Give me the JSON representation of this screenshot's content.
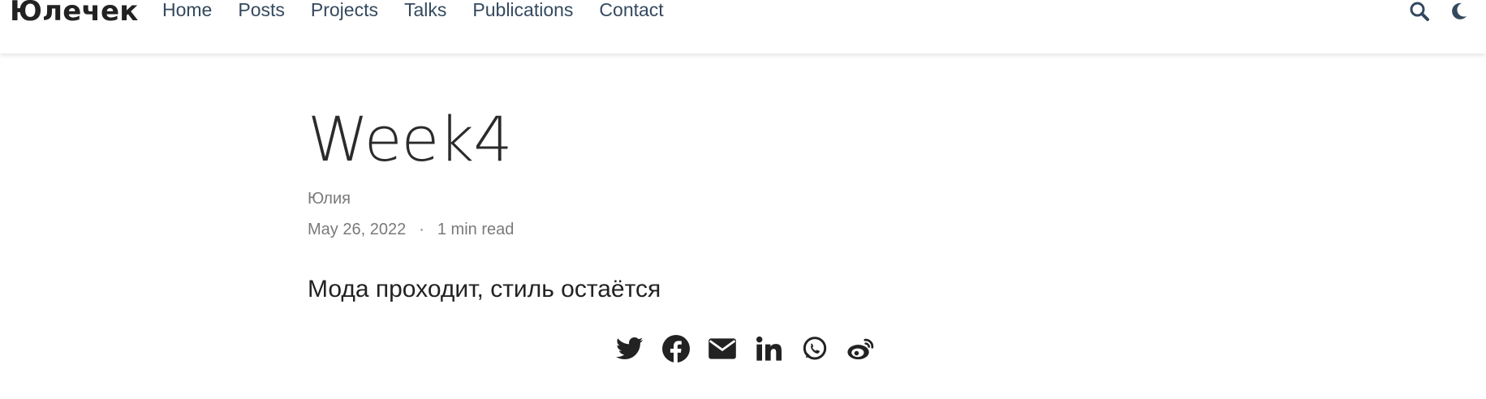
{
  "header": {
    "brand": "Юлечек",
    "nav": [
      {
        "label": "Home"
      },
      {
        "label": "Posts"
      },
      {
        "label": "Projects"
      },
      {
        "label": "Talks"
      },
      {
        "label": "Publications"
      },
      {
        "label": "Contact"
      }
    ],
    "icons": {
      "search": "search-icon",
      "theme": "moon-icon"
    }
  },
  "post": {
    "title": "Week4",
    "author": "Юлия",
    "date": "May 26, 2022",
    "separator": "·",
    "read_time": "1 min read",
    "content": "Мода проходит, стиль остаётся"
  },
  "share": {
    "icons": [
      "twitter-icon",
      "facebook-icon",
      "email-icon",
      "linkedin-icon",
      "whatsapp-icon",
      "weibo-icon"
    ]
  },
  "colors": {
    "nav_text": "#34495e",
    "meta_text": "#7a7a7a",
    "title_text": "#2b2b2b"
  }
}
